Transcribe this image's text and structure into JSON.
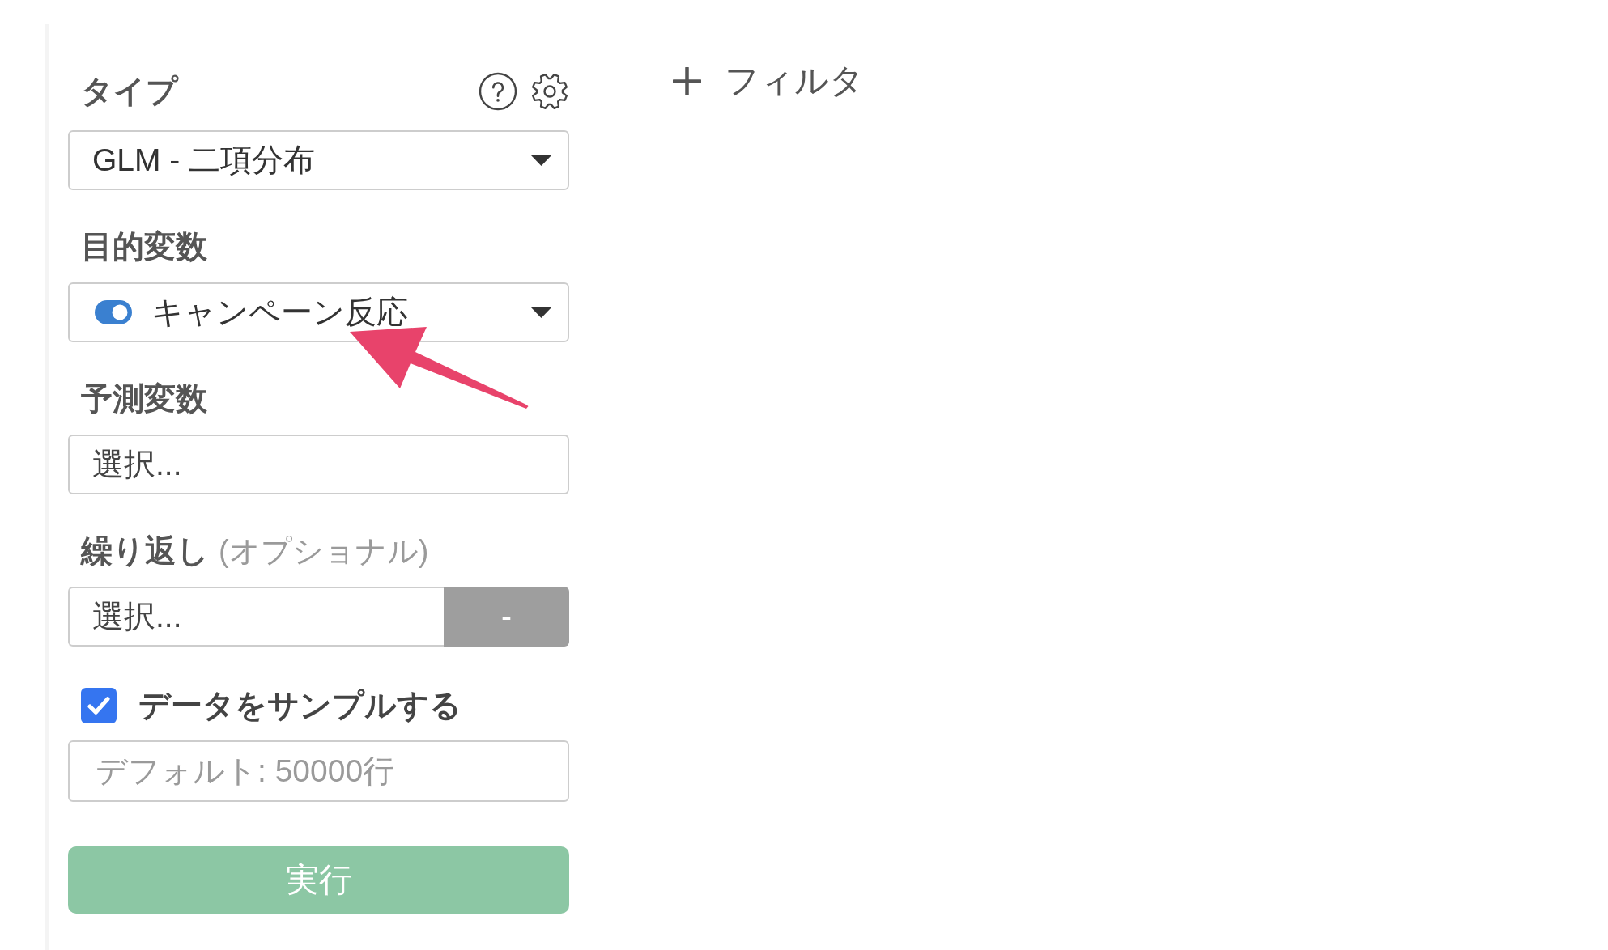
{
  "type": {
    "label": "タイプ",
    "value": "GLM - 二項分布"
  },
  "target": {
    "label": "目的変数",
    "value": "キャンペーン反応"
  },
  "predictors": {
    "label": "予測変数",
    "placeholder": "選択..."
  },
  "repeat": {
    "label": "繰り返し",
    "hint": "(オプショナル)",
    "placeholder": "選択...",
    "button": "-"
  },
  "sample": {
    "label": "データをサンプルする",
    "checked": true,
    "placeholder": "デフォルト: 50000行"
  },
  "run_button": {
    "label": "実行"
  },
  "filter_button": {
    "label": "フィルタ"
  }
}
